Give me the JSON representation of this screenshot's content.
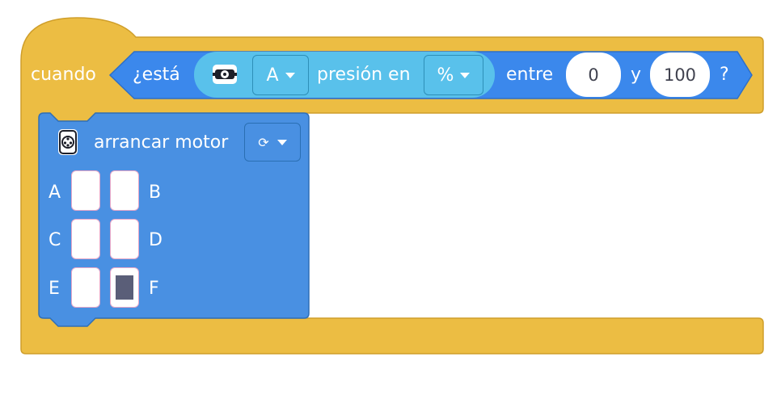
{
  "hat_block": {
    "when_label": "cuando",
    "colors": {
      "events": "#ecbd43",
      "condition": "#3b88ec",
      "condition_inner": "#59c1eb",
      "motor": "#4990e2"
    },
    "condition": {
      "is_label": "¿está",
      "sensor_icon": "force-sensor-icon",
      "port_value": "A",
      "measure_label": "presión en",
      "unit_value": "%",
      "between_label": "entre",
      "min_value": "0",
      "and_label": "y",
      "max_value": "100",
      "end_label": "?"
    }
  },
  "motor_block": {
    "icon": "motor-icon",
    "label": "arrancar motor",
    "direction_icon": "rotate-clockwise-icon",
    "direction_glyph": "⟳",
    "ports": [
      {
        "label": "A",
        "selected": false
      },
      {
        "label": "B",
        "selected": false
      },
      {
        "label": "C",
        "selected": false
      },
      {
        "label": "D",
        "selected": false
      },
      {
        "label": "E",
        "selected": false
      },
      {
        "label": "F",
        "selected": true
      }
    ]
  }
}
